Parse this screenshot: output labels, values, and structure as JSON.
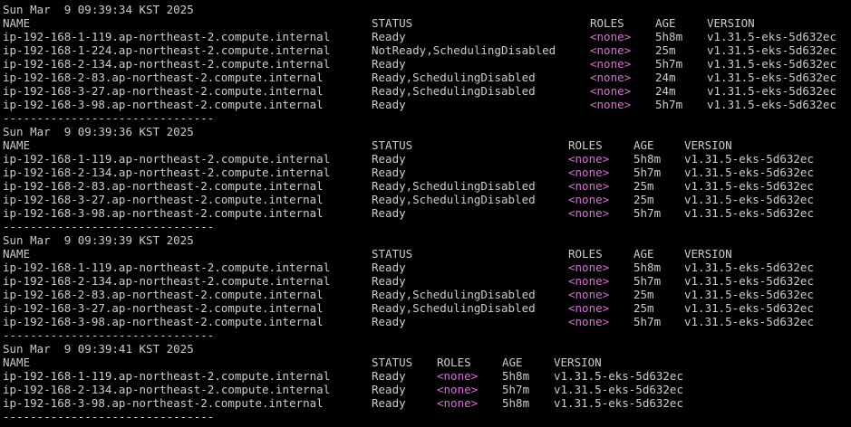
{
  "colors": {
    "background": "#000000",
    "foreground": "#cccccc",
    "role_none": "#d670d6"
  },
  "blocks": [
    {
      "timestamp": "Sun Mar  9 09:39:34 KST 2025",
      "headers": {
        "name": "NAME",
        "status": "STATUS",
        "roles": "ROLES",
        "age": "AGE",
        "version": "VERSION"
      },
      "rows": [
        {
          "name": "ip-192-168-1-119.ap-northeast-2.compute.internal",
          "status": "Ready",
          "roles": "<none>",
          "age": "5h8m",
          "version": "v1.31.5-eks-5d632ec"
        },
        {
          "name": "ip-192-168-1-224.ap-northeast-2.compute.internal",
          "status": "NotReady,SchedulingDisabled",
          "roles": "<none>",
          "age": "25m",
          "version": "v1.31.5-eks-5d632ec"
        },
        {
          "name": "ip-192-168-2-134.ap-northeast-2.compute.internal",
          "status": "Ready",
          "roles": "<none>",
          "age": "5h7m",
          "version": "v1.31.5-eks-5d632ec"
        },
        {
          "name": "ip-192-168-2-83.ap-northeast-2.compute.internal",
          "status": "Ready,SchedulingDisabled",
          "roles": "<none>",
          "age": "24m",
          "version": "v1.31.5-eks-5d632ec"
        },
        {
          "name": "ip-192-168-3-27.ap-northeast-2.compute.internal",
          "status": "Ready,SchedulingDisabled",
          "roles": "<none>",
          "age": "24m",
          "version": "v1.31.5-eks-5d632ec"
        },
        {
          "name": "ip-192-168-3-98.ap-northeast-2.compute.internal",
          "status": "Ready",
          "roles": "<none>",
          "age": "5h7m",
          "version": "v1.31.5-eks-5d632ec"
        }
      ],
      "separator": "-------------------------------"
    },
    {
      "timestamp": "Sun Mar  9 09:39:36 KST 2025",
      "headers": {
        "name": "NAME",
        "status": "STATUS",
        "roles": "ROLES",
        "age": "AGE",
        "version": "VERSION"
      },
      "rows": [
        {
          "name": "ip-192-168-1-119.ap-northeast-2.compute.internal",
          "status": "Ready",
          "roles": "<none>",
          "age": "5h8m",
          "version": "v1.31.5-eks-5d632ec"
        },
        {
          "name": "ip-192-168-2-134.ap-northeast-2.compute.internal",
          "status": "Ready",
          "roles": "<none>",
          "age": "5h7m",
          "version": "v1.31.5-eks-5d632ec"
        },
        {
          "name": "ip-192-168-2-83.ap-northeast-2.compute.internal",
          "status": "Ready,SchedulingDisabled",
          "roles": "<none>",
          "age": "25m",
          "version": "v1.31.5-eks-5d632ec"
        },
        {
          "name": "ip-192-168-3-27.ap-northeast-2.compute.internal",
          "status": "Ready,SchedulingDisabled",
          "roles": "<none>",
          "age": "25m",
          "version": "v1.31.5-eks-5d632ec"
        },
        {
          "name": "ip-192-168-3-98.ap-northeast-2.compute.internal",
          "status": "Ready",
          "roles": "<none>",
          "age": "5h7m",
          "version": "v1.31.5-eks-5d632ec"
        }
      ],
      "separator": "-------------------------------"
    },
    {
      "timestamp": "Sun Mar  9 09:39:39 KST 2025",
      "headers": {
        "name": "NAME",
        "status": "STATUS",
        "roles": "ROLES",
        "age": "AGE",
        "version": "VERSION"
      },
      "rows": [
        {
          "name": "ip-192-168-1-119.ap-northeast-2.compute.internal",
          "status": "Ready",
          "roles": "<none>",
          "age": "5h8m",
          "version": "v1.31.5-eks-5d632ec"
        },
        {
          "name": "ip-192-168-2-134.ap-northeast-2.compute.internal",
          "status": "Ready",
          "roles": "<none>",
          "age": "5h7m",
          "version": "v1.31.5-eks-5d632ec"
        },
        {
          "name": "ip-192-168-2-83.ap-northeast-2.compute.internal",
          "status": "Ready,SchedulingDisabled",
          "roles": "<none>",
          "age": "25m",
          "version": "v1.31.5-eks-5d632ec"
        },
        {
          "name": "ip-192-168-3-27.ap-northeast-2.compute.internal",
          "status": "Ready,SchedulingDisabled",
          "roles": "<none>",
          "age": "25m",
          "version": "v1.31.5-eks-5d632ec"
        },
        {
          "name": "ip-192-168-3-98.ap-northeast-2.compute.internal",
          "status": "Ready",
          "roles": "<none>",
          "age": "5h7m",
          "version": "v1.31.5-eks-5d632ec"
        }
      ],
      "separator": "-------------------------------"
    },
    {
      "timestamp": "Sun Mar  9 09:39:41 KST 2025",
      "headers": {
        "name": "NAME",
        "status": "STATUS",
        "roles": "ROLES",
        "age": "AGE",
        "version": "VERSION"
      },
      "rows": [
        {
          "name": "ip-192-168-1-119.ap-northeast-2.compute.internal",
          "status": "Ready",
          "roles": "<none>",
          "age": "5h8m",
          "version": "v1.31.5-eks-5d632ec"
        },
        {
          "name": "ip-192-168-2-134.ap-northeast-2.compute.internal",
          "status": "Ready",
          "roles": "<none>",
          "age": "5h7m",
          "version": "v1.31.5-eks-5d632ec"
        },
        {
          "name": "ip-192-168-3-98.ap-northeast-2.compute.internal",
          "status": "Ready",
          "roles": "<none>",
          "age": "5h8m",
          "version": "v1.31.5-eks-5d632ec"
        }
      ],
      "separator": "-------------------------------"
    }
  ]
}
